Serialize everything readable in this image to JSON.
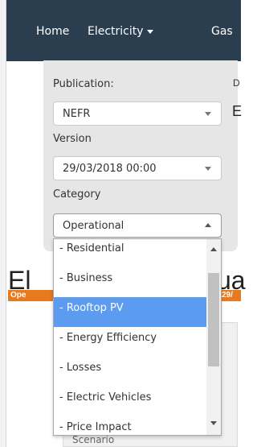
{
  "navbar": {
    "items": [
      {
        "label": "Home"
      },
      {
        "label": "Electricity"
      },
      {
        "label": "Gas"
      }
    ]
  },
  "filters": {
    "publication": {
      "label": "Publication:",
      "value": "NEFR"
    },
    "version": {
      "label": "Version",
      "value": "29/03/2018 00:00"
    },
    "category": {
      "label": "Category",
      "value": "Operational"
    },
    "side_label": "D",
    "side_value": "E"
  },
  "category_dropdown": {
    "options": [
      {
        "label": "- Residential"
      },
      {
        "label": "- Business"
      },
      {
        "label": "- Rooftop PV"
      },
      {
        "label": "- Energy Efficiency"
      },
      {
        "label": "- Losses"
      },
      {
        "label": "- Electric Vehicles"
      },
      {
        "label": "- Price Impact"
      }
    ],
    "selected": "- Rooftop PV",
    "scroll_position": 0.2
  },
  "background": {
    "title_left": "El",
    "title_right": "ua",
    "badge_left": "Ope",
    "badge_right": "29/",
    "scenario_label": "Scenario"
  },
  "colors": {
    "navbar": "#2b3e50",
    "selected_option": "#5b9bf0",
    "badge": "#e8791e",
    "panel": "#e6e6e6"
  }
}
